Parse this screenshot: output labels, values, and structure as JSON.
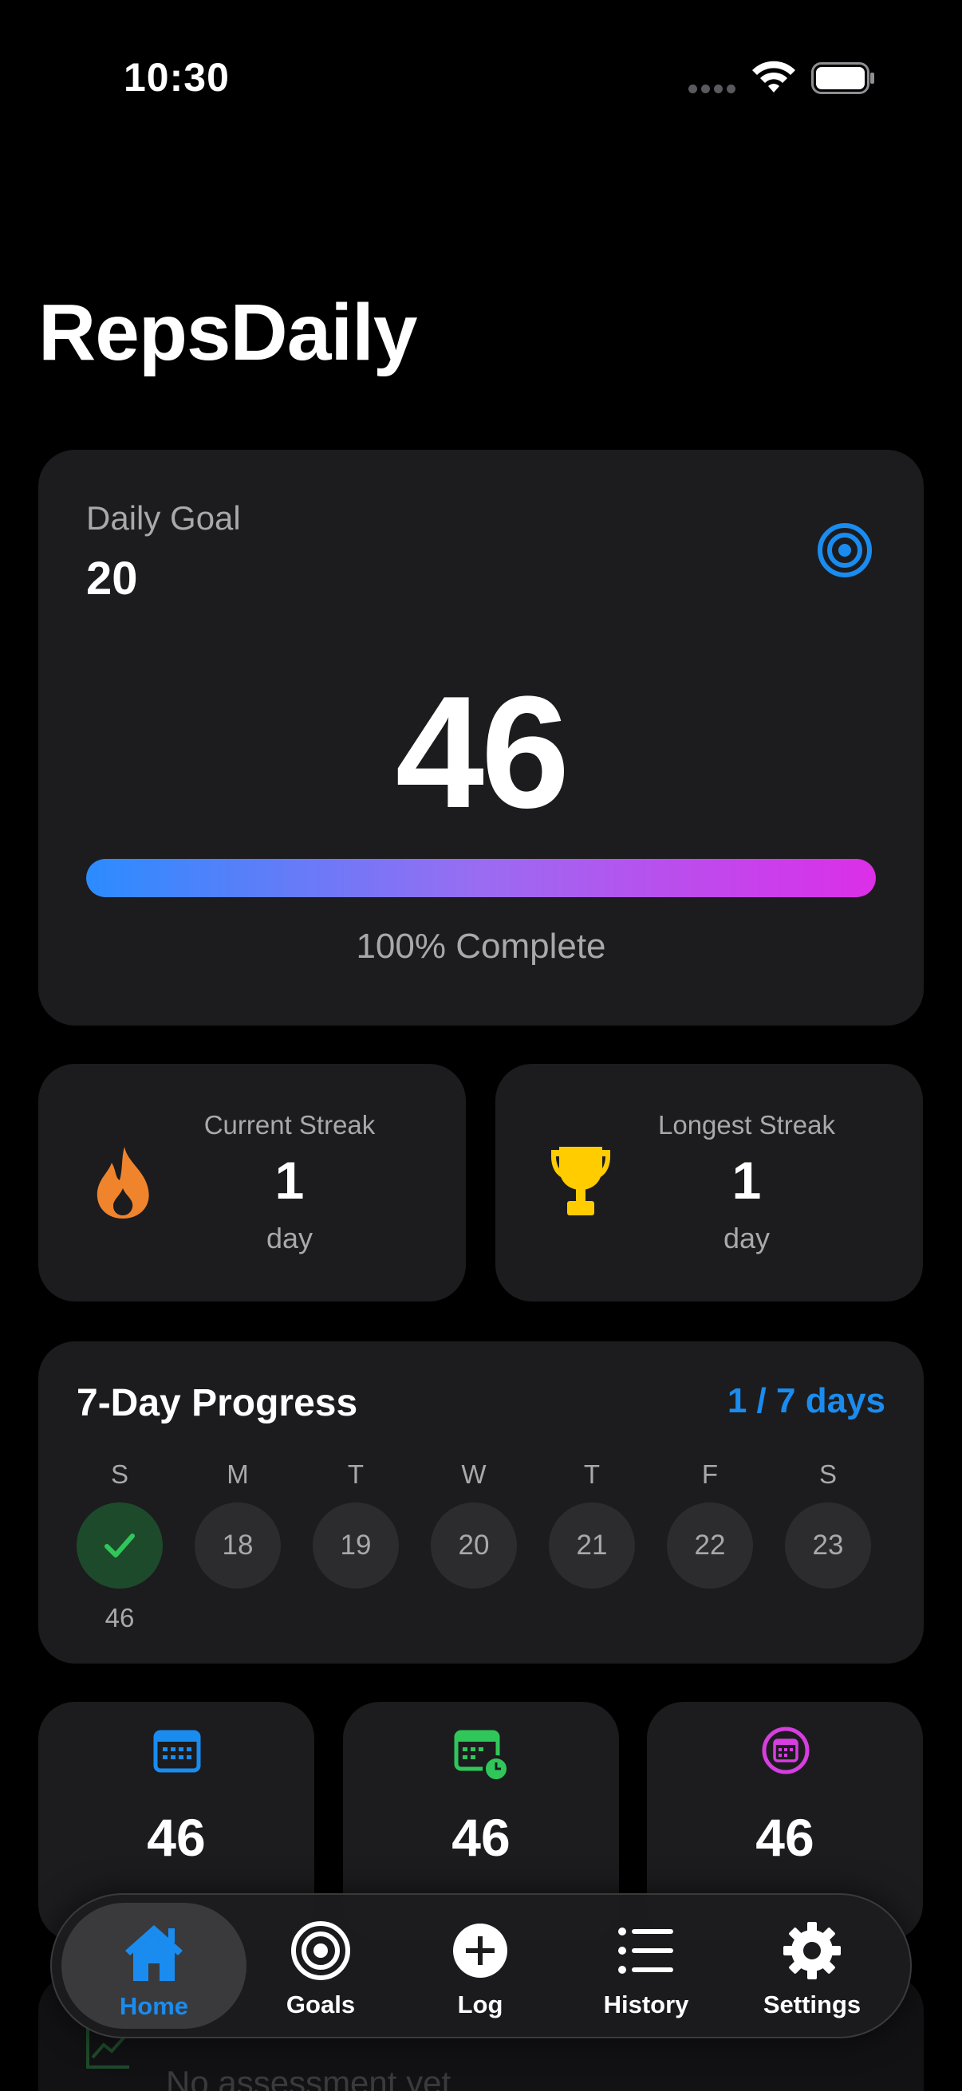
{
  "status_bar": {
    "time": "10:30"
  },
  "app": {
    "title": "RepsDaily"
  },
  "daily_goal": {
    "label": "Daily Goal",
    "goal": "20",
    "count": "46",
    "progress_fraction": 1.0,
    "progress_label": "100% Complete",
    "colors": {
      "start": "#2b8cff",
      "end": "#dc2ee8",
      "icon": "#1a8cf0"
    },
    "icon": "target-icon"
  },
  "streaks": {
    "current": {
      "caption": "Current Streak",
      "value": "1",
      "unit": "day",
      "icon": "flame-icon",
      "color": "#f0842c"
    },
    "longest": {
      "caption": "Longest Streak",
      "value": "1",
      "unit": "day",
      "icon": "trophy-icon",
      "color": "#ffcc00"
    }
  },
  "week": {
    "title": "7-Day Progress",
    "summary": "1 / 7 days",
    "days": [
      {
        "letter": "S",
        "date": "",
        "done": true,
        "reps": "46"
      },
      {
        "letter": "M",
        "date": "18",
        "done": false,
        "reps": ""
      },
      {
        "letter": "T",
        "date": "19",
        "done": false,
        "reps": ""
      },
      {
        "letter": "W",
        "date": "20",
        "done": false,
        "reps": ""
      },
      {
        "letter": "T",
        "date": "21",
        "done": false,
        "reps": ""
      },
      {
        "letter": "F",
        "date": "22",
        "done": false,
        "reps": ""
      },
      {
        "letter": "S",
        "date": "23",
        "done": false,
        "reps": ""
      }
    ]
  },
  "mini_stats": [
    {
      "value": "46",
      "icon": "calendar-icon",
      "color": "#1a8cf0"
    },
    {
      "value": "46",
      "icon": "calendar-clock-icon",
      "color": "#30c75a"
    },
    {
      "value": "46",
      "icon": "calendar-circle-icon",
      "color": "#d63ee0"
    }
  ],
  "assessment": {
    "text": "No assessment yet"
  },
  "tab_bar": {
    "items": [
      {
        "label": "Home",
        "icon": "house-icon",
        "active": true
      },
      {
        "label": "Goals",
        "icon": "target-icon"
      },
      {
        "label": "Log",
        "icon": "plus-circle-icon"
      },
      {
        "label": "History",
        "icon": "list-icon"
      },
      {
        "label": "Settings",
        "icon": "gear-icon"
      }
    ]
  }
}
